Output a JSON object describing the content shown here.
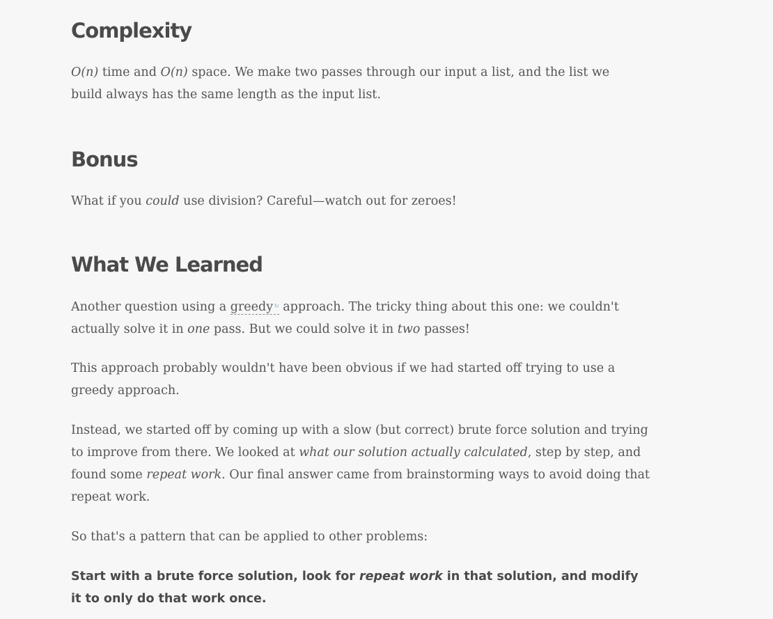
{
  "complexity": {
    "heading": "Complexity",
    "math_time": "O(n)",
    "time_label": " time and ",
    "math_space": "O(n)",
    "rest": " space. We make two passes through our input a list, and the list we build always has the same length as the input list."
  },
  "bonus": {
    "heading": "Bonus",
    "pre": "What if you ",
    "em": "could",
    "post": " use division? Careful—watch out for zeroes!"
  },
  "learned": {
    "heading": "What We Learned",
    "p1": {
      "pre": "Another question using a ",
      "term": "greedy",
      "term_icon": "↻",
      "mid": " approach. The tricky thing about this one: we couldn't actually solve it in ",
      "em1": "one",
      "mid2": " pass. But we could solve it in ",
      "em2": "two",
      "post": " passes!"
    },
    "p2": "This approach probably wouldn't have been obvious if we had started off trying to use a greedy approach.",
    "p3": {
      "pre": "Instead, we started off by coming up with a slow (but correct) brute force solution and trying to improve from there. We looked at ",
      "em1": "what our solution actually calculated",
      "mid": ", step by step, and found some ",
      "em2": "repeat work",
      "post": ". Our final answer came from brainstorming ways to avoid doing that repeat work."
    },
    "p4": "So that's a pattern that can be applied to other problems:",
    "p5": {
      "pre": "Start with a brute force solution, look for ",
      "em": "repeat work",
      "post": " in that solution, and modify it to only do that work once."
    }
  }
}
